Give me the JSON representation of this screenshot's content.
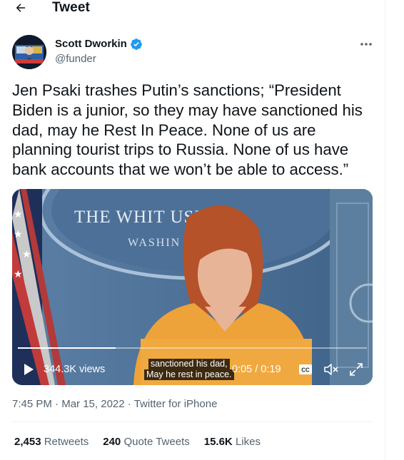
{
  "header": {
    "title": "Tweet",
    "back_icon": "arrow-left-icon"
  },
  "author": {
    "name": "Scott Dworkin",
    "handle": "@funder",
    "verified": true,
    "verified_color": "#1d9bf0"
  },
  "tweet": {
    "text": "Jen Psaki trashes Putin’s sanctions; “President Biden is a junior, so they may have sanctioned his dad, may he Rest In Peace. None of us are planning tourist trips to Russia. None of us have bank accounts that we won’t be able to access.”"
  },
  "video": {
    "views": "344.3K views",
    "caption_line1": "sanctioned his dad,",
    "caption_line2": "May he rest in peace.",
    "time": "0:05 / 0:19",
    "progress": 0.28,
    "backdrop_text_top": "THE WHIT    USE",
    "backdrop_text_bottom": "WASHIN",
    "cc_label": "CC"
  },
  "meta": {
    "time": "7:45 PM",
    "date": "Mar 15, 2022",
    "source": "Twitter for iPhone",
    "separator": "·"
  },
  "stats": {
    "retweets_count": "2,453",
    "retweets_label": "Retweets",
    "quotes_count": "240",
    "quotes_label": "Quote Tweets",
    "likes_count": "15.6K",
    "likes_label": "Likes"
  }
}
